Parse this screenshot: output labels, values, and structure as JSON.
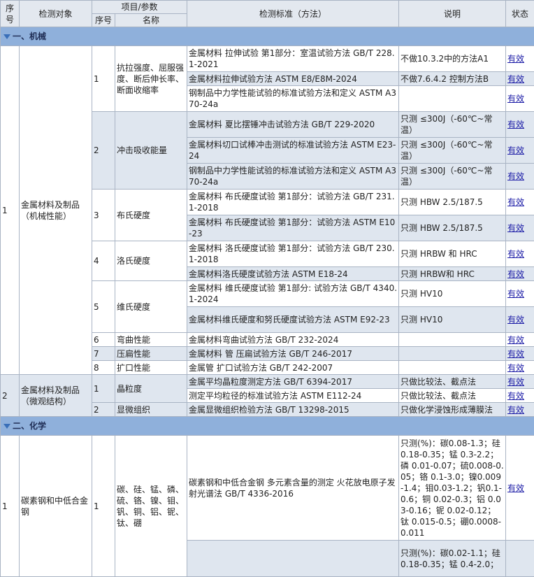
{
  "header": {
    "col_seq": "序号",
    "col_object": "检测对象",
    "col_item_group": "项目/参数",
    "col_item_seq": "序号",
    "col_item_name": "名称",
    "col_standard": "检测标准（方法）",
    "col_note": "说明",
    "col_status": "状态"
  },
  "sections": [
    {
      "title": "一、机械"
    },
    {
      "title": "二、化学"
    }
  ],
  "groups": [
    {
      "seq": "1",
      "object": "金属材料及制品（机械性能）"
    },
    {
      "seq": "2",
      "object": "金属材料及制品（微观结构）"
    },
    {
      "seq": "1",
      "object": "碳素钢和中低合金钢"
    }
  ],
  "items": [
    {
      "seq": "1",
      "name": "抗拉强度、屈服强度、断后伸长率、断面收缩率"
    },
    {
      "seq": "2",
      "name": "冲击吸收能量"
    },
    {
      "seq": "3",
      "name": "布氏硬度"
    },
    {
      "seq": "4",
      "name": "洛氏硬度"
    },
    {
      "seq": "5",
      "name": "维氏硬度"
    },
    {
      "seq": "6",
      "name": "弯曲性能"
    },
    {
      "seq": "7",
      "name": "压扁性能"
    },
    {
      "seq": "8",
      "name": "扩口性能"
    },
    {
      "seq": "1",
      "name": "晶粒度"
    },
    {
      "seq": "2",
      "name": "显微组织"
    },
    {
      "seq": "1",
      "name": "碳、硅、锰、磷、硫、铬、镍、钼、钒、铜、铝、铌、钛、硼"
    }
  ],
  "rows": [
    {
      "standard": "金属材料 拉伸试验 第1部分：室温试验方法 GB/T 228.1-2021",
      "note": "不做10.3.2中的方法A1",
      "status": "有效"
    },
    {
      "standard": "金属材料拉伸试验方法 ASTM E8/E8M-2024",
      "note": "不做7.6.4.2 控制方法B",
      "status": "有效"
    },
    {
      "standard": "钢制品中力学性能试验的标准试验方法和定义 ASTM A370-24a",
      "note": "",
      "status": "有效"
    },
    {
      "standard": "金属材料 夏比摆锤冲击试验方法 GB/T 229-2020",
      "note": "只测 ≤300J（-60℃~常温）",
      "status": "有效"
    },
    {
      "standard": "金属材料切口试棒冲击测试的标准试验方法 ASTM E23-24",
      "note": "只测 ≤300J（-60℃~常温）",
      "status": "有效"
    },
    {
      "standard": "钢制品中力学性能试验的标准试验方法和定义 ASTM A370-24a",
      "note": "只测 ≤300J（-60℃~常温）",
      "status": "有效"
    },
    {
      "standard": "金属材料 布氏硬度试验 第1部分：试验方法 GB/T 231.1-2018",
      "note": "只测 HBW 2.5/187.5",
      "status": "有效"
    },
    {
      "standard": "金属材料 布氏硬度试验 第1部分：试验方法 ASTM E10-23",
      "note": "只测 HBW 2.5/187.5",
      "status": "有效"
    },
    {
      "standard": "金属材料 洛氏硬度试验 第1部分：试验方法 GB/T 230.1-2018",
      "note": "只测 HRBW 和 HRC",
      "status": "有效"
    },
    {
      "standard": "金属材料洛氏硬度试验方法 ASTM E18-24",
      "note": "只测 HRBW和 HRC",
      "status": "有效"
    },
    {
      "standard": "金属材料 维氏硬度试验 第1部分: 试验方法 GB/T 4340.1-2024",
      "note": "只测 HV10",
      "status": "有效"
    },
    {
      "standard": "金属材料维氏硬度和努氏硬度试验方法 ASTM E92-23",
      "note": "只测 HV10",
      "status": "有效"
    },
    {
      "standard": "金属材料弯曲试验方法 GB/T 232-2024",
      "note": "",
      "status": "有效"
    },
    {
      "standard": "金属材料 管 压扁试验方法 GB/T 246-2017",
      "note": "",
      "status": "有效"
    },
    {
      "standard": "金属管 扩口试验方法 GB/T 242-2007",
      "note": "",
      "status": "有效"
    },
    {
      "standard": "金属平均晶粒度测定方法 GB/T 6394-2017",
      "note": "只做比较法、截点法",
      "status": "有效"
    },
    {
      "standard": "测定平均粒径的标准试验方法 ASTM E112-24",
      "note": "只做比较法、截点法",
      "status": "有效"
    },
    {
      "standard": "金属显微组织检验方法 GB/T 13298-2015",
      "note": "只做化学浸蚀形成薄膜法",
      "status": "有效"
    },
    {
      "standard": "碳素钢和中低合金钢 多元素含量的测定 火花放电原子发射光谱法 GB/T 4336-2016",
      "note": "只测(%)：碳0.08-1.3；硅0.18-0.35；锰 0.3-2.2；磷 0.01-0.07；硫0.008-0.05；铬 0.1-3.0；镍0.009-1.4；钼0.03-1.2；钒0.1-0.6；铜 0.02-0.3；铝 0.03-0.16；铌 0.02-0.12；钛 0.015-0.5；硼0.0008-0.011",
      "status": "有效"
    },
    {
      "standard": "",
      "note": "只测(%)：碳0.02-1.1；硅0.18-0.35；锰 0.4-2.0；",
      "status": ""
    }
  ]
}
